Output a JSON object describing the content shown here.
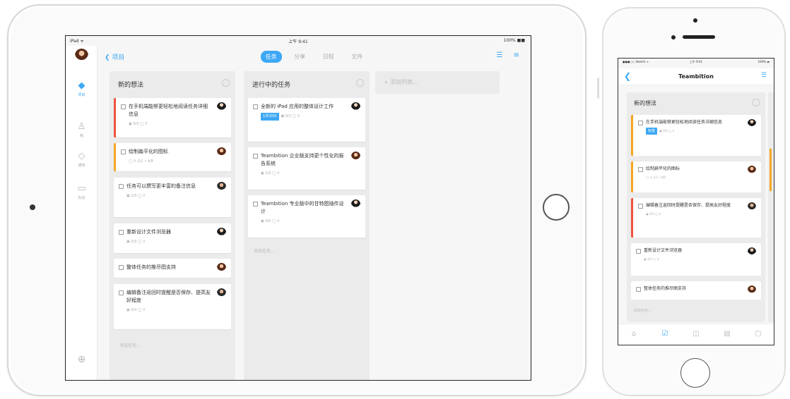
{
  "ipad": {
    "status": {
      "carrier": "iPad ᯤ",
      "time": "上午 9:41",
      "battery": "100% ■■"
    },
    "rail": {
      "items": [
        {
          "icon": "layers-icon",
          "glyph": "◆",
          "label": "项目",
          "active": true
        },
        {
          "icon": "user-icon",
          "glyph": "♙",
          "label": "我",
          "active": false
        },
        {
          "icon": "bell-icon",
          "glyph": "◇",
          "label": "通知",
          "active": false
        },
        {
          "icon": "chat-icon",
          "glyph": "▭",
          "label": "私信",
          "active": false
        }
      ],
      "add_glyph": "⊕"
    },
    "nav": {
      "back_label": "❮ 项目",
      "tabs": [
        "任务",
        "分享",
        "日程",
        "文件"
      ],
      "active_tab": 0,
      "right_icons": "☰ ≡"
    },
    "columns": [
      {
        "title": "新的想法",
        "cards": [
          {
            "text": "在手机端能够更轻松地阅读任务详细信息",
            "meta": "▣ 0/3  ◯  ⚲",
            "bar": "red"
          },
          {
            "text": "绘制扁平化的图标",
            "meta": "◯  ⚲  凸1  • 4/8",
            "bar": "orange"
          },
          {
            "text": "任务可以撰写更丰富的备注信息",
            "meta": "▣ 2/3  ◯  ⚲",
            "bar": ""
          },
          {
            "text": "重新设计文件浏览器",
            "meta": "▣ 3/3  ◯  ⚲",
            "bar": ""
          },
          {
            "text": "整体任务的推尽图支持",
            "meta": "",
            "bar": ""
          },
          {
            "text": "编辑备注返回时提醒是否保存、提高友好程度",
            "meta": "▣ 0/3  ◯  ⚲",
            "bar": ""
          }
        ],
        "add_task": "添加任务..."
      },
      {
        "title": "进行中的任务",
        "cards": [
          {
            "text": "全新的 iPad 应用的整体设计工作",
            "tag": "1月30日",
            "meta": "▣ 0/3  ◯  ⚲",
            "bar": ""
          },
          {
            "text": "Teambition 企业版支持更个性化的报告系统",
            "meta": "▣ 1/3  ◯  ⚲",
            "bar": ""
          },
          {
            "text": "Teambition 专业版中的甘特图插件设计",
            "meta": "▣ 4/5  ◯  ⚲",
            "bar": ""
          }
        ],
        "add_task": "添加任务..."
      }
    ],
    "add_list": "+ 添加列表..."
  },
  "iphone": {
    "status": {
      "carrier": "●●●○○ Sketch ᯤ",
      "time": "上午 9:41",
      "battery": "100% ▬"
    },
    "nav": {
      "back": "❮",
      "title": "Teambition",
      "right": "☰"
    },
    "column": {
      "title": "新的想法",
      "cards": [
        {
          "text": "在手机端能够更轻松地阅读任务详细信息",
          "tag": "标签",
          "meta": "▣ 0/3  ◯  ⚲",
          "bar": "orange"
        },
        {
          "text": "绘制扁平化的图标",
          "meta": "◯  ⚲  凸1  • 4/8",
          "bar": "orange"
        },
        {
          "text": "编辑备注返回时提醒是否保存、提高友好程度",
          "meta": "▣ 0/3  ◯  ⚲",
          "bar": "red"
        },
        {
          "text": "重新设计文件浏览器",
          "meta": "▣ 3/3  ◯  ⚲",
          "bar": ""
        },
        {
          "text": "整体任务的推尽图支持",
          "meta": "",
          "bar": ""
        }
      ],
      "add_task": "添加任务..."
    },
    "dots": "• • • • •",
    "tabbar": [
      "⌂",
      "☑",
      "◫",
      "▤",
      "▢"
    ],
    "active_tab": 1
  },
  "colors": {
    "accent": "#3da8f5",
    "red_bar": "#f0523f",
    "orange_bar": "#f5a623"
  }
}
